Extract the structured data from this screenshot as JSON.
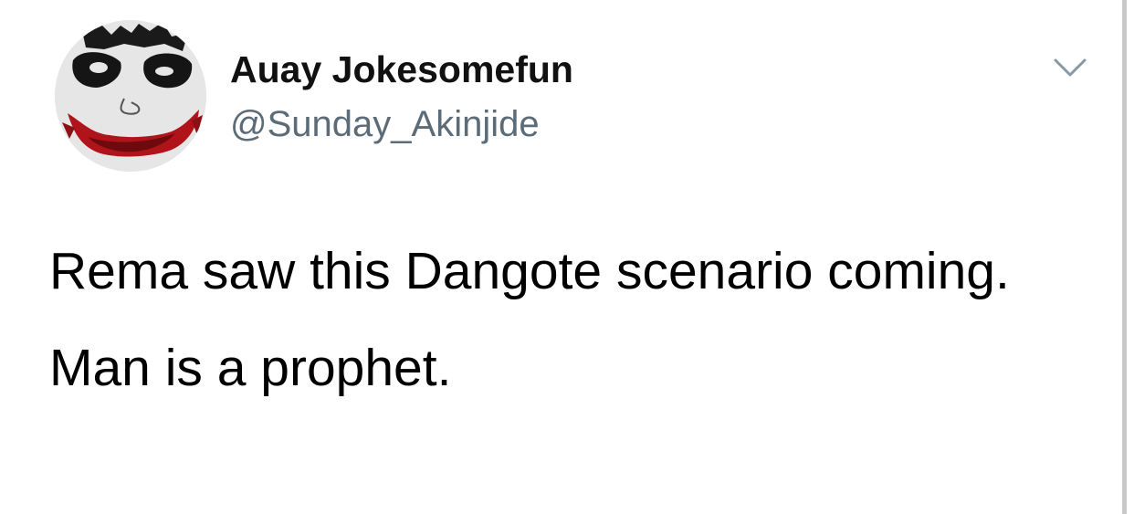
{
  "author": {
    "display_name": "Auay Jokesomefun",
    "handle": "@Sunday_Akinjide",
    "avatar_icon": "joker-face-avatar"
  },
  "menu": {
    "icon": "chevron-down-icon"
  },
  "tweet": {
    "paragraphs": [
      "Rema saw this Dangote scenario coming.",
      "Man is a prophet."
    ]
  },
  "colors": {
    "background": "#ffffff",
    "text": "#000000",
    "handle": "#5b6b78",
    "chevron": "#8899a6",
    "scrollbar": "#c9c9c9"
  }
}
